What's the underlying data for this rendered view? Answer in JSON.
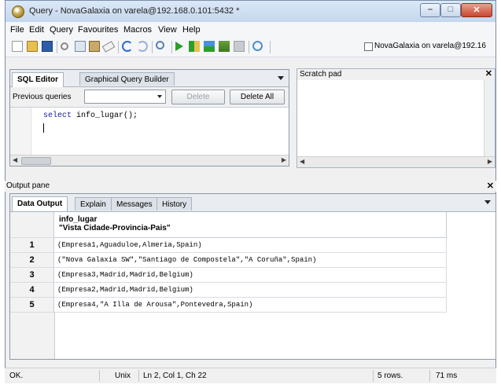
{
  "window": {
    "title": "Query - NovaGalaxia on varela@192.168.0.101:5432 *",
    "min_glyph": "–",
    "max_glyph": "□",
    "close_glyph": "✕"
  },
  "menubar": {
    "items": [
      "File",
      "Edit",
      "Query",
      "Favourites",
      "Macros",
      "View",
      "Help"
    ]
  },
  "toolbar": {
    "icons": [
      "new-file-icon",
      "open-folder-icon",
      "save-icon",
      "cut-icon",
      "copy-icon",
      "paste-icon",
      "eraser-icon",
      "undo-icon",
      "redo-icon",
      "find-icon",
      "execute-icon",
      "explain-icon",
      "execute-to-file-icon",
      "analyze-icon",
      "stop-icon",
      "help-icon"
    ],
    "connection_label": "NovaGalaxia on varela@192.16"
  },
  "sql_editor": {
    "tabs": [
      "SQL Editor",
      "Graphical Query Builder"
    ],
    "previous_queries_label": "Previous queries",
    "previous_queries_value": "",
    "delete_label": "Delete",
    "delete_all_label": "Delete All",
    "code_keyword": "select",
    "code_rest": " info_lugar();"
  },
  "scratch_pad": {
    "title": "Scratch pad",
    "close_glyph": "✕"
  },
  "output_pane": {
    "title": "Output pane",
    "close_glyph": "✕",
    "tabs": [
      "Data Output",
      "Explain",
      "Messages",
      "History"
    ],
    "column_name": "info_lugar",
    "column_type": "\"Vista Cidade-Provincia-Pais\"",
    "rows": [
      {
        "num": "1",
        "value": "(Empresa1,Aguaduloe,Almeria,Spain)"
      },
      {
        "num": "2",
        "value": "(\"Nova Galaxia SW\",\"Santiago de Compostela\",\"A Coruña\",Spain)"
      },
      {
        "num": "3",
        "value": "(Empresa3,Madrid,Madrid,Belgium)"
      },
      {
        "num": "4",
        "value": "(Empresa2,Madrid,Madrid,Belgium)"
      },
      {
        "num": "5",
        "value": "(Empresa4,\"A Illa de Arousa\",Pontevedra,Spain)"
      }
    ]
  },
  "statusbar": {
    "status": "OK.",
    "line_endings": "Unix",
    "position": "Ln 2, Col 1, Ch 22",
    "rows": "5 rows.",
    "time": "71 ms"
  }
}
